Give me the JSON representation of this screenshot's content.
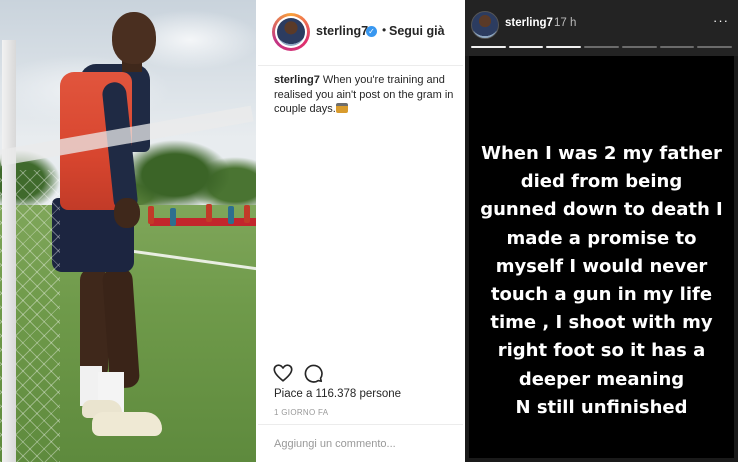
{
  "post": {
    "username": "sterling7",
    "verified_badge": "✓",
    "separator": "•",
    "follow_label": "Segui già",
    "caption_user": "sterling7",
    "caption_text": "When you're training and realised you ain't post on the gram in couple days.",
    "caption_emoji": "camera-with-flash-emoji",
    "likes": "Piace a 116.378 persone",
    "time": "1 GIORNO FA",
    "comment_placeholder": "Aggiungi un commento..."
  },
  "story": {
    "username": "sterling7",
    "time": "17 h",
    "more_label": "···",
    "progress_segments": 7,
    "current_segment": 3,
    "text_lines": [
      "When I was 2 my father",
      "died from being",
      "gunned down to death I",
      "made a promise to",
      "myself I would never",
      "touch a gun in my life",
      "time , I shoot with my",
      "right foot so it has a",
      "deeper meaning",
      "N still unfinished"
    ]
  },
  "icons": {
    "like": "heart-icon",
    "comment": "comment-bubble-icon",
    "verified": "verified-badge-icon",
    "more": "more-options-icon"
  },
  "colors": {
    "verified_blue": "#3897f0",
    "story_background": "#000000",
    "text_dark": "#262626",
    "muted": "#999999"
  }
}
